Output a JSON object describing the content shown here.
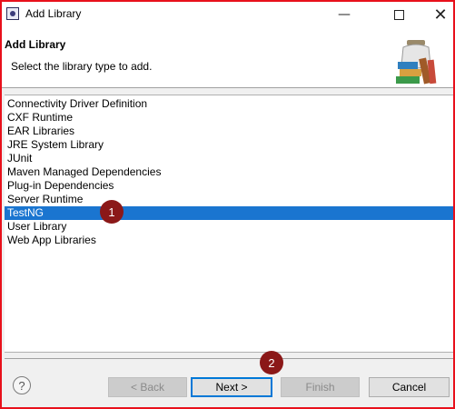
{
  "window": {
    "title": "Add Library",
    "minimize_glyph": "—",
    "close_glyph": "✕",
    "border_color": "#e8101b"
  },
  "header": {
    "title": "Add Library",
    "description": "Select the library type to add.",
    "banner_icon": "library-books-jar-icon"
  },
  "list": {
    "items": [
      "Connectivity Driver Definition",
      "CXF Runtime",
      "EAR Libraries",
      "JRE System Library",
      "JUnit",
      "Maven Managed Dependencies",
      "Plug-in Dependencies",
      "Server Runtime",
      "TestNG",
      "User Library",
      "Web App Libraries"
    ],
    "selected": "TestNG",
    "selection_color": "#1a75d0"
  },
  "annotations": [
    "1",
    "2"
  ],
  "buttons": {
    "help": "?",
    "back": "< Back",
    "next": "Next >",
    "finish": "Finish",
    "cancel": "Cancel"
  }
}
